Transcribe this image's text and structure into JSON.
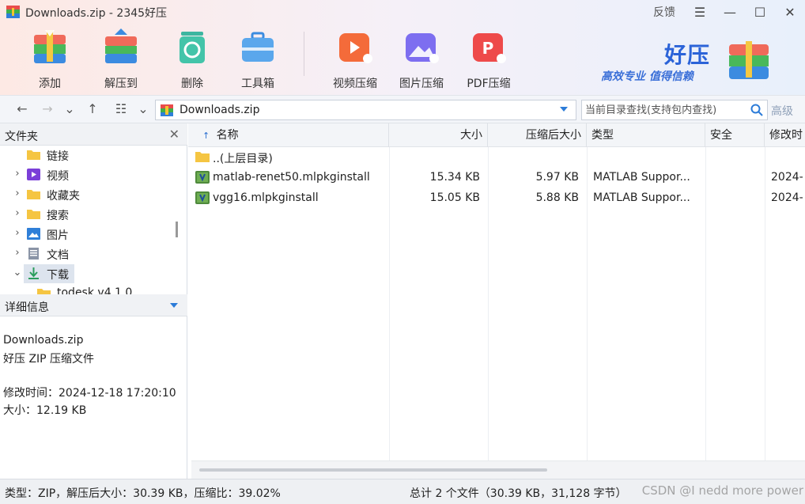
{
  "window": {
    "title": "Downloads.zip - 2345好压",
    "feedback": "反馈",
    "menu_glyph": "☰",
    "minimize_glyph": "—",
    "maximize_glyph": "☐",
    "close_glyph": "✕"
  },
  "toolbar": {
    "add": "添加",
    "extract": "解压到",
    "delete": "删除",
    "tools": "工具箱",
    "video": "视频压缩",
    "image": "图片压缩",
    "pdf": "PDF压缩"
  },
  "brand": {
    "name": "好压",
    "slogan": "高效专业 值得信赖"
  },
  "address": {
    "back": "←",
    "forward": "→",
    "history": "⌄",
    "up": "↑",
    "view": "☷",
    "view_dd": "⌄",
    "path": "Downloads.zip",
    "search_placeholder": "当前目录查找(支持包内查找)",
    "advanced": "高级"
  },
  "folder_panel": {
    "title": "文件夹",
    "close": "✕",
    "items": [
      {
        "label": "链接",
        "chevron": ""
      },
      {
        "label": "视频",
        "chevron": "›"
      },
      {
        "label": "收藏夹",
        "chevron": "›"
      },
      {
        "label": "搜索",
        "chevron": "›"
      },
      {
        "label": "图片",
        "chevron": "›"
      },
      {
        "label": "文档",
        "chevron": "›"
      },
      {
        "label": "下载",
        "chevron": "⌄"
      },
      {
        "label": "todesk v4.1.0",
        "chevron": ""
      }
    ]
  },
  "details_panel": {
    "title": "详细信息",
    "name": "Downloads.zip",
    "type": "好压 ZIP 压缩文件",
    "modified": "修改时间：2024-12-18 17:20:10",
    "size": "大小：12.19 KB"
  },
  "columns": {
    "sort_arrow": "↑",
    "name": "名称",
    "size": "大小",
    "packed": "压缩后大小",
    "type": "类型",
    "security": "安全",
    "modified": "修改时"
  },
  "files": [
    {
      "name": "..(上层目录)",
      "size": "",
      "packed": "",
      "type": "",
      "modified": ""
    },
    {
      "name": "matlab-renet50.mlpkginstall",
      "size": "15.34 KB",
      "packed": "5.97 KB",
      "type": "MATLAB Suppor...",
      "modified": "2024-"
    },
    {
      "name": "vgg16.mlpkginstall",
      "size": "15.05 KB",
      "packed": "5.88 KB",
      "type": "MATLAB Suppor...",
      "modified": "2024-"
    }
  ],
  "status": {
    "left": "类型：ZIP，解压后大小：30.39 KB，压缩比：39.02%",
    "right": "总计 2 个文件（30.39 KB，31,128 字节）",
    "watermark": "CSDN @I nedd more power"
  }
}
